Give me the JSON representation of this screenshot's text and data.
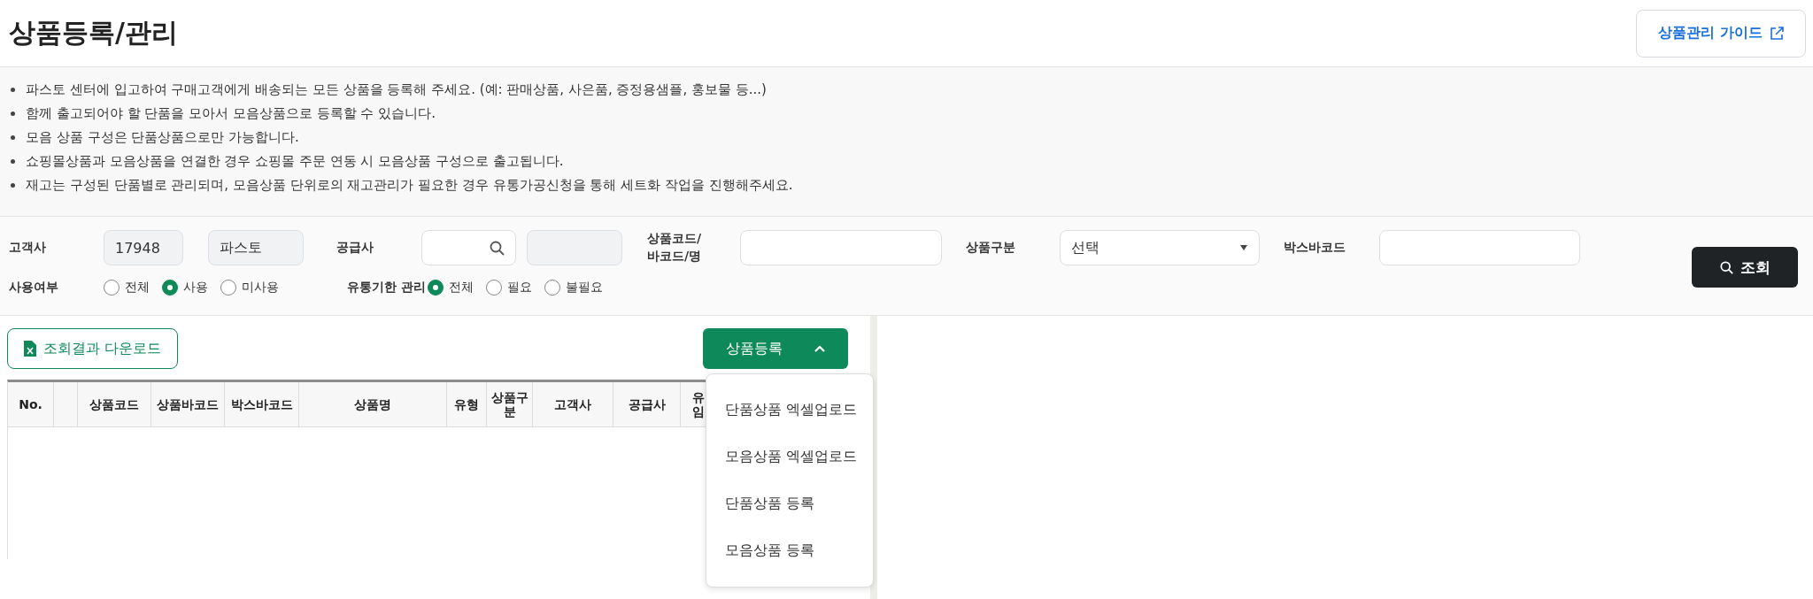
{
  "header": {
    "title": "상품등록/관리",
    "guide_button": "상품관리 가이드"
  },
  "notes": [
    "파스토 센터에 입고하여 구매고객에게 배송되는 모든 상품을 등록해 주세요. (예: 판매상품, 사은품, 증정용샘플, 홍보물 등...)",
    "함께 출고되어야 할 단품을 모아서 모음상품으로 등록할 수 있습니다.",
    "모음 상품 구성은 단품상품으로만 가능합니다.",
    "쇼핑몰상품과 모음상품을 연결한 경우 쇼핑몰 주문 연동 시 모음상품 구성으로 출고됩니다.",
    "재고는 구성된 단품별로 관리되며, 모음상품 단위로의 재고관리가 필요한 경우 유통가공신청을 통해 세트화 작업을 진행해주세요."
  ],
  "filters": {
    "customer_label": "고객사",
    "customer_code": "17948",
    "customer_name": "파스토",
    "supplier_label": "공급사",
    "product_label": "상품코드/\n바코드/명",
    "category_label": "상품구분",
    "category_select": "선택",
    "box_barcode_label": "박스바코드",
    "search_button": "조회",
    "usage_label": "사용여부",
    "usage_options": [
      {
        "label": "전체",
        "selected": false
      },
      {
        "label": "사용",
        "selected": true
      },
      {
        "label": "미사용",
        "selected": false
      }
    ],
    "expiry_label": "유통기한 관리",
    "expiry_options": [
      {
        "label": "전체",
        "selected": true
      },
      {
        "label": "필요",
        "selected": false
      },
      {
        "label": "불필요",
        "selected": false
      }
    ]
  },
  "toolbar": {
    "download_button": "조회결과 다운로드",
    "register_button": "상품등록",
    "register_menu_expanded": true
  },
  "register_menu": [
    "단품상품 엑셀업로드",
    "모음상품 엑셀업로드",
    "단품상품 등록",
    "모음상품 등록"
  ],
  "table": {
    "columns": [
      "No.",
      "",
      "상품코드",
      "상품바코드",
      "박스바코드",
      "상품명",
      "유형",
      "상품구\n분",
      "고객사",
      "공급사",
      "유\n임"
    ]
  }
}
